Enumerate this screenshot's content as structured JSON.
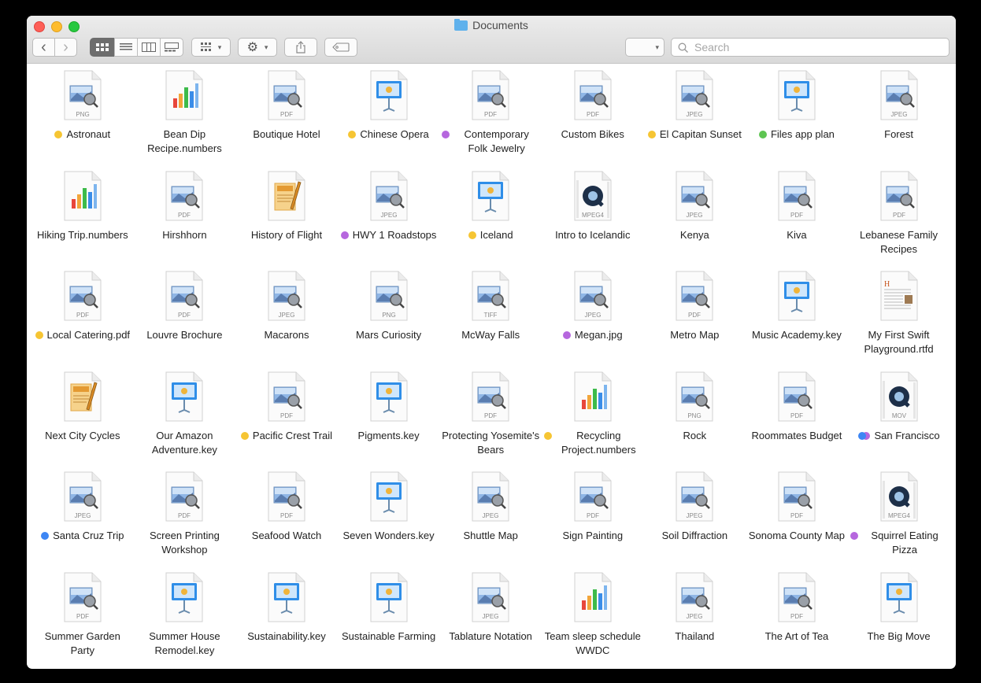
{
  "window": {
    "title": "Documents",
    "folder_color": "#5fb1ec"
  },
  "toolbar": {
    "back_glyph": "‹",
    "forward_glyph": "›",
    "view_modes": [
      "icon-view",
      "list-view",
      "column-view",
      "gallery-view"
    ],
    "active_view": "icon-view",
    "search": {
      "value": "",
      "placeholder": "Search"
    }
  },
  "tag_colors": {
    "yellow": "#f6c533",
    "purple": "#b667de",
    "green": "#5ec552",
    "blue": "#3d86f4"
  },
  "files": [
    {
      "name": "Astronaut",
      "ext": "PNG",
      "kind": "image",
      "tags": [
        "yellow"
      ]
    },
    {
      "name": "Bean Dip Recipe.numbers",
      "ext": "",
      "kind": "numbers",
      "tags": []
    },
    {
      "name": "Boutique Hotel",
      "ext": "PDF",
      "kind": "image",
      "tags": []
    },
    {
      "name": "Chinese Opera",
      "ext": "",
      "kind": "keynote",
      "tags": [
        "yellow"
      ]
    },
    {
      "name": "Contemporary Folk Jewelry",
      "ext": "PDF",
      "kind": "image",
      "tags": [
        "purple"
      ]
    },
    {
      "name": "Custom Bikes",
      "ext": "PDF",
      "kind": "image",
      "tags": []
    },
    {
      "name": "El Capitan Sunset",
      "ext": "JPEG",
      "kind": "image",
      "tags": [
        "yellow"
      ]
    },
    {
      "name": "Files app plan",
      "ext": "",
      "kind": "keynote",
      "tags": [
        "green"
      ]
    },
    {
      "name": "Forest",
      "ext": "JPEG",
      "kind": "image",
      "tags": []
    },
    {
      "name": "Hiking Trip.numbers",
      "ext": "",
      "kind": "numbers",
      "tags": []
    },
    {
      "name": "Hirshhorn",
      "ext": "PDF",
      "kind": "image",
      "tags": []
    },
    {
      "name": "History of Flight",
      "ext": "",
      "kind": "pages",
      "tags": []
    },
    {
      "name": "HWY 1 Roadstops",
      "ext": "JPEG",
      "kind": "image",
      "tags": [
        "purple"
      ]
    },
    {
      "name": "Iceland",
      "ext": "",
      "kind": "keynote",
      "tags": [
        "yellow"
      ]
    },
    {
      "name": "Intro to Icelandic",
      "ext": "MPEG4",
      "kind": "video",
      "tags": []
    },
    {
      "name": "Kenya",
      "ext": "JPEG",
      "kind": "image",
      "tags": []
    },
    {
      "name": "Kiva",
      "ext": "PDF",
      "kind": "image",
      "tags": []
    },
    {
      "name": "Lebanese Family Recipes",
      "ext": "PDF",
      "kind": "image",
      "tags": []
    },
    {
      "name": "Local Catering.pdf",
      "ext": "PDF",
      "kind": "image",
      "tags": [
        "yellow"
      ]
    },
    {
      "name": "Louvre Brochure",
      "ext": "PDF",
      "kind": "image",
      "tags": []
    },
    {
      "name": "Macarons",
      "ext": "JPEG",
      "kind": "image",
      "tags": []
    },
    {
      "name": "Mars Curiosity",
      "ext": "PNG",
      "kind": "image",
      "tags": []
    },
    {
      "name": "McWay Falls",
      "ext": "TIFF",
      "kind": "image",
      "tags": []
    },
    {
      "name": "Megan.jpg",
      "ext": "JPEG",
      "kind": "image",
      "tags": [
        "purple"
      ]
    },
    {
      "name": "Metro Map",
      "ext": "PDF",
      "kind": "image",
      "tags": []
    },
    {
      "name": "Music Academy.key",
      "ext": "",
      "kind": "keynote",
      "tags": []
    },
    {
      "name": "My First Swift Playground.rtfd",
      "ext": "",
      "kind": "rtfd",
      "tags": []
    },
    {
      "name": "Next City Cycles",
      "ext": "",
      "kind": "pages",
      "tags": []
    },
    {
      "name": "Our Amazon Adventure.key",
      "ext": "",
      "kind": "keynote",
      "tags": []
    },
    {
      "name": "Pacific Crest Trail",
      "ext": "PDF",
      "kind": "image",
      "tags": [
        "yellow"
      ]
    },
    {
      "name": "Pigments.key",
      "ext": "",
      "kind": "keynote",
      "tags": []
    },
    {
      "name": "Protecting Yosemite's Bears",
      "ext": "PDF",
      "kind": "image",
      "tags": []
    },
    {
      "name": "Recycling Project.numbers",
      "ext": "",
      "kind": "numbers",
      "tags": [
        "yellow"
      ]
    },
    {
      "name": "Rock",
      "ext": "PNG",
      "kind": "image",
      "tags": []
    },
    {
      "name": "Roommates Budget",
      "ext": "PDF",
      "kind": "image",
      "tags": []
    },
    {
      "name": "San Francisco",
      "ext": "MOV",
      "kind": "video",
      "tags": [
        "blue",
        "purple"
      ]
    },
    {
      "name": "Santa Cruz Trip",
      "ext": "JPEG",
      "kind": "image",
      "tags": [
        "blue"
      ]
    },
    {
      "name": "Screen Printing Workshop",
      "ext": "PDF",
      "kind": "image",
      "tags": []
    },
    {
      "name": "Seafood Watch",
      "ext": "PDF",
      "kind": "image",
      "tags": []
    },
    {
      "name": "Seven Wonders.key",
      "ext": "",
      "kind": "keynote",
      "tags": []
    },
    {
      "name": "Shuttle Map",
      "ext": "JPEG",
      "kind": "image",
      "tags": []
    },
    {
      "name": "Sign Painting",
      "ext": "PDF",
      "kind": "image",
      "tags": []
    },
    {
      "name": "Soil Diffraction",
      "ext": "JPEG",
      "kind": "image",
      "tags": []
    },
    {
      "name": "Sonoma County Map",
      "ext": "PDF",
      "kind": "image",
      "tags": []
    },
    {
      "name": "Squirrel Eating Pizza",
      "ext": "MPEG4",
      "kind": "video",
      "tags": [
        "purple"
      ]
    },
    {
      "name": "Summer Garden Party",
      "ext": "PDF",
      "kind": "image",
      "tags": []
    },
    {
      "name": "Summer House Remodel.key",
      "ext": "",
      "kind": "keynote",
      "tags": []
    },
    {
      "name": "Sustainability.key",
      "ext": "",
      "kind": "keynote",
      "tags": []
    },
    {
      "name": "Sustainable Farming",
      "ext": "",
      "kind": "keynote",
      "tags": []
    },
    {
      "name": "Tablature Notation",
      "ext": "JPEG",
      "kind": "image",
      "tags": []
    },
    {
      "name": "Team sleep schedule WWDC",
      "ext": "",
      "kind": "numbers",
      "tags": []
    },
    {
      "name": "Thailand",
      "ext": "JPEG",
      "kind": "image",
      "tags": []
    },
    {
      "name": "The Art of Tea",
      "ext": "PDF",
      "kind": "image",
      "tags": []
    },
    {
      "name": "The Big Move",
      "ext": "",
      "kind": "keynote",
      "tags": []
    }
  ]
}
